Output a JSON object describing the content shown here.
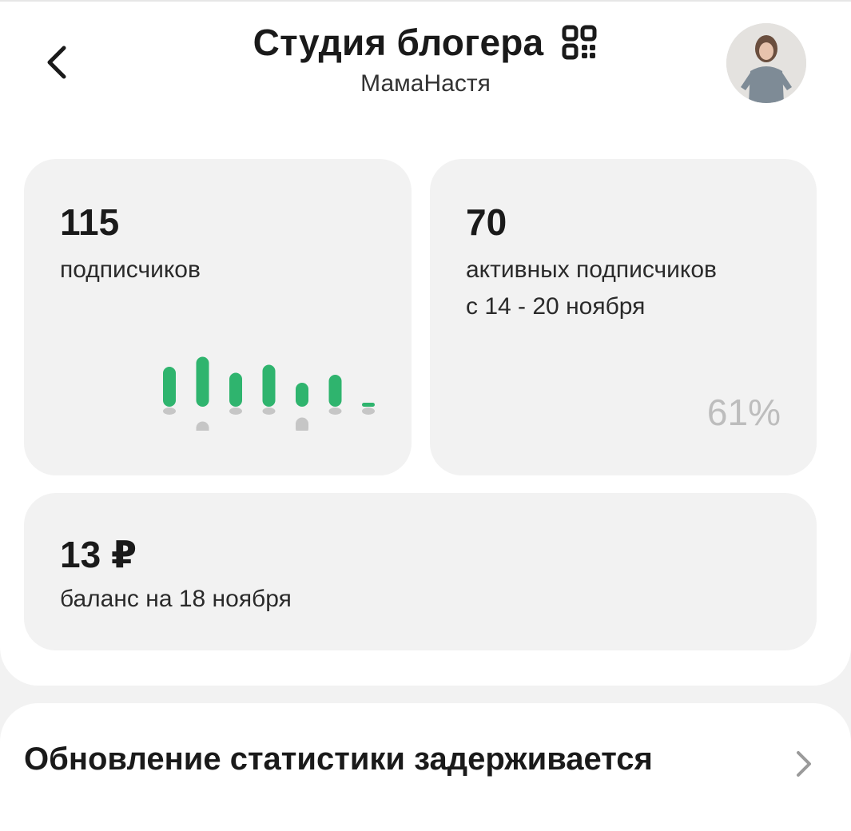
{
  "header": {
    "title": "Студия блогера",
    "subtitle": "МамаНастя",
    "back_icon": "chevron-left-icon",
    "qr_icon": "qr-code-icon",
    "avatar_alt": "МамаНастя"
  },
  "cards": {
    "subscribers": {
      "value": "115",
      "label": "подписчиков",
      "chart_data": {
        "type": "bar",
        "series": [
          {
            "values": [
              1.0,
              1.25,
              0.85,
              1.05,
              0.6,
              0.8,
              0.1
            ]
          },
          {
            "values": [
              -0.1,
              -0.45,
              -0.1,
              -0.1,
              -0.35,
              -0.1,
              -0.1
            ]
          }
        ],
        "colors": [
          "#2fb46e",
          "#c6c6c6"
        ]
      }
    },
    "active": {
      "value": "70",
      "label_line1": "активных подписчиков",
      "label_line2": "с 14 - 20 ноября",
      "percent": "61%"
    },
    "balance": {
      "value": "13 ₽",
      "label": "баланс на 18 ноября"
    }
  },
  "notice": {
    "text": "Обновление статистики задерживается",
    "chevron_icon": "chevron-right-icon"
  },
  "colors": {
    "accent_green": "#2fb46e",
    "card_bg": "#f2f2f2",
    "muted": "#bdbdbd"
  }
}
